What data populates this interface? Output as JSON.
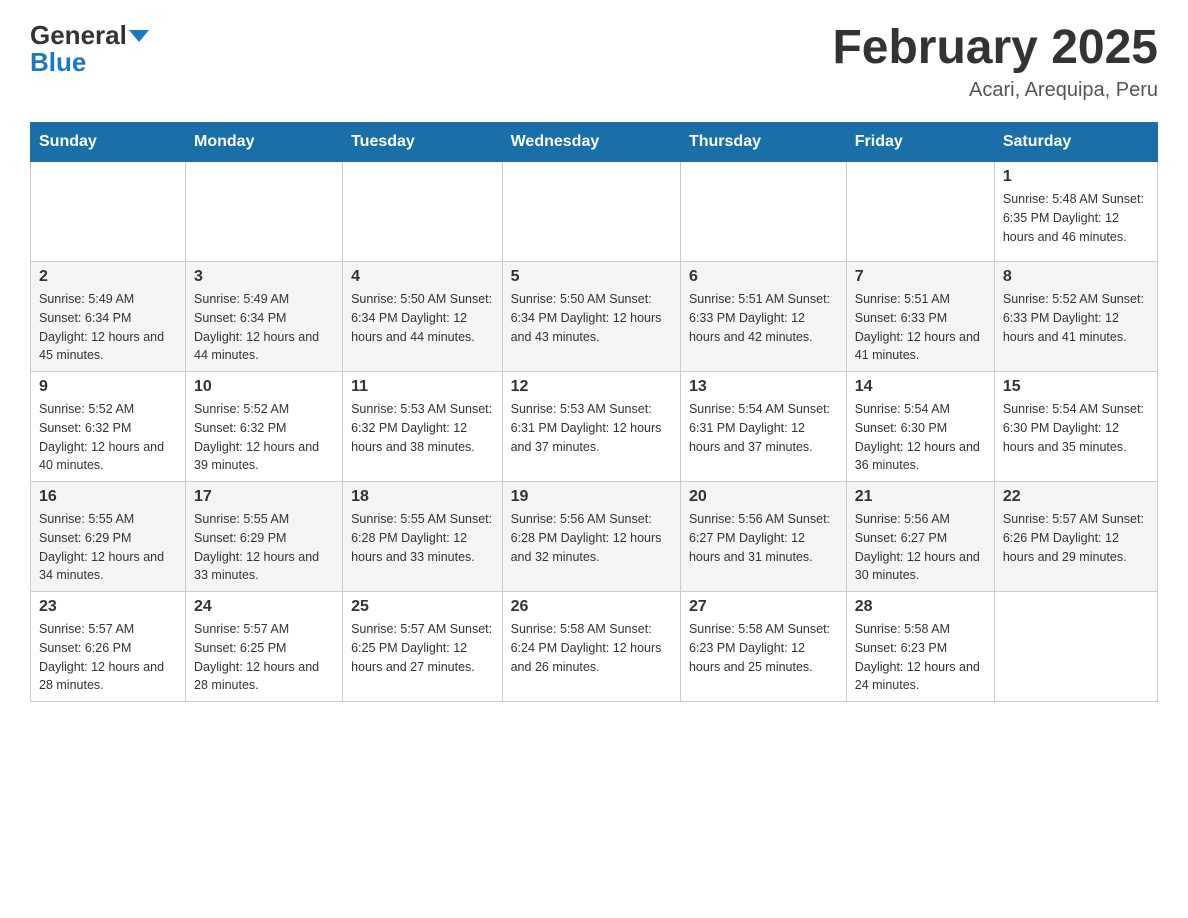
{
  "header": {
    "logo": {
      "general": "General",
      "blue": "Blue"
    },
    "title": "February 2025",
    "location": "Acari, Arequipa, Peru"
  },
  "days_of_week": [
    "Sunday",
    "Monday",
    "Tuesday",
    "Wednesday",
    "Thursday",
    "Friday",
    "Saturday"
  ],
  "weeks": [
    {
      "days": [
        {
          "num": "",
          "info": ""
        },
        {
          "num": "",
          "info": ""
        },
        {
          "num": "",
          "info": ""
        },
        {
          "num": "",
          "info": ""
        },
        {
          "num": "",
          "info": ""
        },
        {
          "num": "",
          "info": ""
        },
        {
          "num": "1",
          "info": "Sunrise: 5:48 AM\nSunset: 6:35 PM\nDaylight: 12 hours\nand 46 minutes."
        }
      ]
    },
    {
      "days": [
        {
          "num": "2",
          "info": "Sunrise: 5:49 AM\nSunset: 6:34 PM\nDaylight: 12 hours\nand 45 minutes."
        },
        {
          "num": "3",
          "info": "Sunrise: 5:49 AM\nSunset: 6:34 PM\nDaylight: 12 hours\nand 44 minutes."
        },
        {
          "num": "4",
          "info": "Sunrise: 5:50 AM\nSunset: 6:34 PM\nDaylight: 12 hours\nand 44 minutes."
        },
        {
          "num": "5",
          "info": "Sunrise: 5:50 AM\nSunset: 6:34 PM\nDaylight: 12 hours\nand 43 minutes."
        },
        {
          "num": "6",
          "info": "Sunrise: 5:51 AM\nSunset: 6:33 PM\nDaylight: 12 hours\nand 42 minutes."
        },
        {
          "num": "7",
          "info": "Sunrise: 5:51 AM\nSunset: 6:33 PM\nDaylight: 12 hours\nand 41 minutes."
        },
        {
          "num": "8",
          "info": "Sunrise: 5:52 AM\nSunset: 6:33 PM\nDaylight: 12 hours\nand 41 minutes."
        }
      ]
    },
    {
      "days": [
        {
          "num": "9",
          "info": "Sunrise: 5:52 AM\nSunset: 6:32 PM\nDaylight: 12 hours\nand 40 minutes."
        },
        {
          "num": "10",
          "info": "Sunrise: 5:52 AM\nSunset: 6:32 PM\nDaylight: 12 hours\nand 39 minutes."
        },
        {
          "num": "11",
          "info": "Sunrise: 5:53 AM\nSunset: 6:32 PM\nDaylight: 12 hours\nand 38 minutes."
        },
        {
          "num": "12",
          "info": "Sunrise: 5:53 AM\nSunset: 6:31 PM\nDaylight: 12 hours\nand 37 minutes."
        },
        {
          "num": "13",
          "info": "Sunrise: 5:54 AM\nSunset: 6:31 PM\nDaylight: 12 hours\nand 37 minutes."
        },
        {
          "num": "14",
          "info": "Sunrise: 5:54 AM\nSunset: 6:30 PM\nDaylight: 12 hours\nand 36 minutes."
        },
        {
          "num": "15",
          "info": "Sunrise: 5:54 AM\nSunset: 6:30 PM\nDaylight: 12 hours\nand 35 minutes."
        }
      ]
    },
    {
      "days": [
        {
          "num": "16",
          "info": "Sunrise: 5:55 AM\nSunset: 6:29 PM\nDaylight: 12 hours\nand 34 minutes."
        },
        {
          "num": "17",
          "info": "Sunrise: 5:55 AM\nSunset: 6:29 PM\nDaylight: 12 hours\nand 33 minutes."
        },
        {
          "num": "18",
          "info": "Sunrise: 5:55 AM\nSunset: 6:28 PM\nDaylight: 12 hours\nand 33 minutes."
        },
        {
          "num": "19",
          "info": "Sunrise: 5:56 AM\nSunset: 6:28 PM\nDaylight: 12 hours\nand 32 minutes."
        },
        {
          "num": "20",
          "info": "Sunrise: 5:56 AM\nSunset: 6:27 PM\nDaylight: 12 hours\nand 31 minutes."
        },
        {
          "num": "21",
          "info": "Sunrise: 5:56 AM\nSunset: 6:27 PM\nDaylight: 12 hours\nand 30 minutes."
        },
        {
          "num": "22",
          "info": "Sunrise: 5:57 AM\nSunset: 6:26 PM\nDaylight: 12 hours\nand 29 minutes."
        }
      ]
    },
    {
      "days": [
        {
          "num": "23",
          "info": "Sunrise: 5:57 AM\nSunset: 6:26 PM\nDaylight: 12 hours\nand 28 minutes."
        },
        {
          "num": "24",
          "info": "Sunrise: 5:57 AM\nSunset: 6:25 PM\nDaylight: 12 hours\nand 28 minutes."
        },
        {
          "num": "25",
          "info": "Sunrise: 5:57 AM\nSunset: 6:25 PM\nDaylight: 12 hours\nand 27 minutes."
        },
        {
          "num": "26",
          "info": "Sunrise: 5:58 AM\nSunset: 6:24 PM\nDaylight: 12 hours\nand 26 minutes."
        },
        {
          "num": "27",
          "info": "Sunrise: 5:58 AM\nSunset: 6:23 PM\nDaylight: 12 hours\nand 25 minutes."
        },
        {
          "num": "28",
          "info": "Sunrise: 5:58 AM\nSunset: 6:23 PM\nDaylight: 12 hours\nand 24 minutes."
        },
        {
          "num": "",
          "info": ""
        }
      ]
    }
  ]
}
